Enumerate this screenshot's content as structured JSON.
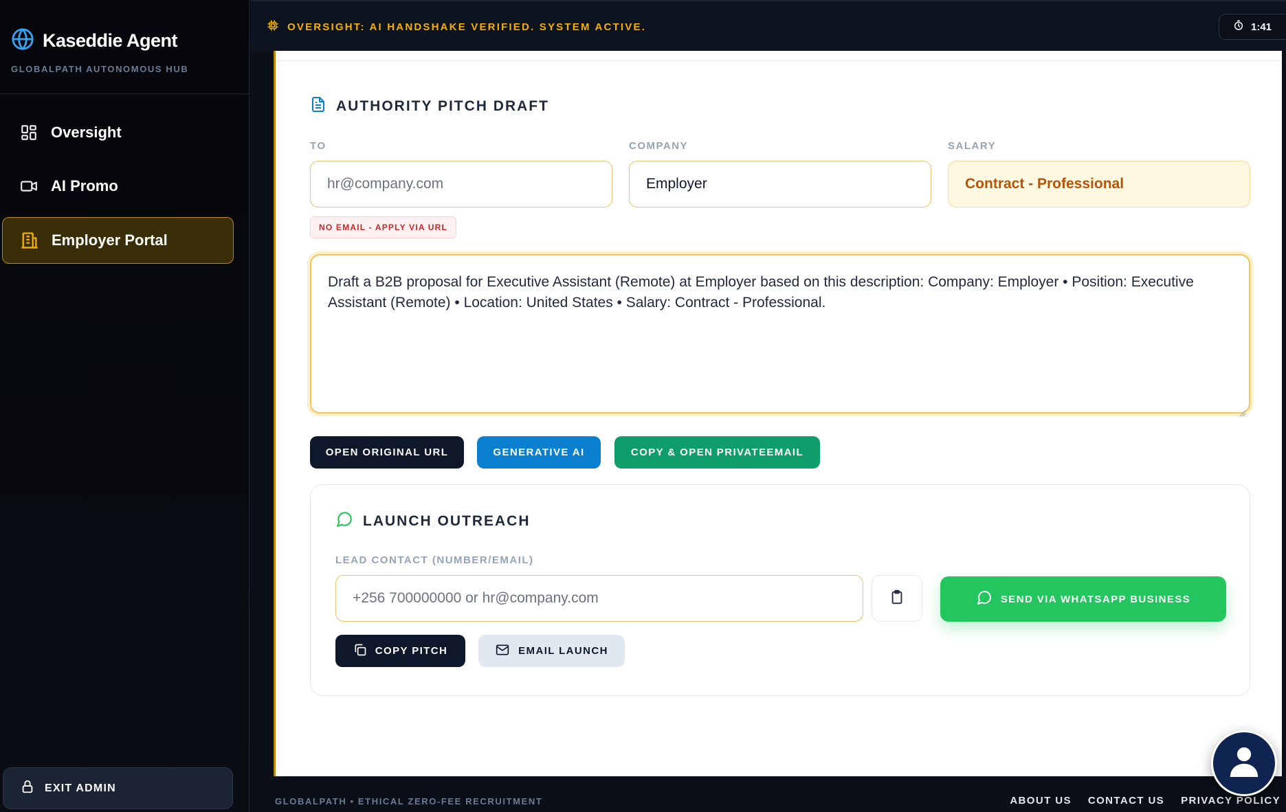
{
  "app": {
    "title": "Kaseddie Agent",
    "subtitle": "GLOBALPATH AUTONOMOUS HUB"
  },
  "sidebar": {
    "items": [
      {
        "label": "Oversight",
        "icon": "grid-icon",
        "active": false
      },
      {
        "label": "AI Promo",
        "icon": "video-camera-icon",
        "active": false
      },
      {
        "label": "Employer Portal",
        "icon": "building-icon",
        "active": true
      }
    ],
    "exit_label": "EXIT ADMIN"
  },
  "topbar": {
    "status": "OVERSIGHT: AI HANDSHAKE VERIFIED. SYSTEM ACTIVE.",
    "timer": "1:41"
  },
  "pitch": {
    "title": "AUTHORITY PITCH DRAFT",
    "to_label": "TO",
    "to_placeholder": "hr@company.com",
    "company_label": "COMPANY",
    "company_value": "Employer",
    "salary_label": "SALARY",
    "salary_value": "Contract - Professional",
    "no_email_badge": "NO EMAIL - APPLY VIA URL",
    "draft_text": "Draft a B2B proposal for Executive Assistant (Remote) at Employer based on this description: Company: Employer • Position: Executive Assistant (Remote) • Location: United States • Salary: Contract - Professional.",
    "buttons": {
      "open_url": "OPEN ORIGINAL URL",
      "generative_ai": "GENERATIVE AI",
      "copy_open_email": "COPY & OPEN PRIVATEEMAIL"
    }
  },
  "outreach": {
    "title": "LAUNCH OUTREACH",
    "contact_label": "LEAD CONTACT (NUMBER/EMAIL)",
    "contact_placeholder": "+256 700000000 or hr@company.com",
    "whatsapp_label": "SEND VIA WHATSAPP BUSINESS",
    "copy_pitch_label": "COPY PITCH",
    "email_launch_label": "EMAIL LAUNCH"
  },
  "footer": {
    "tagline": "GLOBALPATH • ETHICAL ZERO-FEE RECRUITMENT",
    "links": [
      "ABOUT US",
      "CONTACT US",
      "PRIVACY POLICY"
    ]
  },
  "colors": {
    "accent": "#f5b000",
    "active_border": "#b8870e",
    "whatsapp": "#22c55e",
    "primary_blue": "#0b7fcf",
    "teal": "#0f9d6b"
  }
}
